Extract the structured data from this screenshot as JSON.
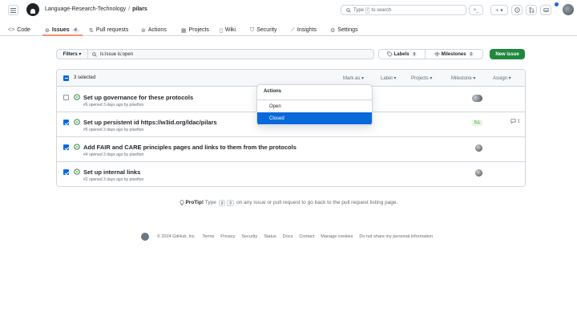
{
  "header": {
    "owner": "Language-Research-Technology",
    "separator": "/",
    "repo": "pilars",
    "search_prefix": "Type",
    "search_key": "/",
    "search_suffix": "to search",
    "terminal_label": ">_",
    "plus_label": "+ ▾"
  },
  "tabs": [
    {
      "icon": "<>",
      "label": "Code"
    },
    {
      "icon": "⊙",
      "label": "Issues",
      "count": "4"
    },
    {
      "icon": "⇅",
      "label": "Pull requests"
    },
    {
      "icon": "⊛",
      "label": "Actions"
    },
    {
      "icon": "▦",
      "label": "Projects"
    },
    {
      "icon": "▯",
      "label": "Wiki"
    },
    {
      "icon": "⛉",
      "label": "Security"
    },
    {
      "icon": "⟋",
      "label": "Insights"
    },
    {
      "icon": "⚙",
      "label": "Settings"
    }
  ],
  "filter_bar": {
    "filters_label": "Filters ▾",
    "query": "is:issue is:open",
    "labels_label": "Labels",
    "labels_count": "9",
    "milestones_label": "Milestones",
    "milestones_count": "0",
    "new_issue_label": "New issue"
  },
  "list_header": {
    "selected_text": "3 selected",
    "mark_as": "Mark as ▾",
    "label": "Label ▾",
    "projects": "Projects ▾",
    "milestone": "Milestone ▾",
    "assignee": "Assign ▾"
  },
  "issues": [
    {
      "title": "Set up governance for these protocols",
      "meta": "#6 opened 3 days ago by ptsefton",
      "checked": false
    },
    {
      "title": "Set up persistent id https://w3id.org/ldac/pilars",
      "meta": "#5 opened 3 days ago by ptsefton",
      "checked": true,
      "comments": "1",
      "assignee_label": "!LL"
    },
    {
      "title": "Add FAIR and CARE principles pages and links to them from the protocols",
      "meta": "#4 opened 3 days ago by ptsefton",
      "checked": true
    },
    {
      "title": "Set up internal links",
      "meta": "#2 opened 3 days ago by ptsefton",
      "checked": true
    }
  ],
  "menu": {
    "title": "Actions",
    "items": [
      "Open",
      "Closed"
    ],
    "highlighted": "Closed"
  },
  "protip": {
    "label": "ProTip!",
    "before": "Type",
    "key1": "g",
    "key2": "p",
    "after": "on any issue or pull request to go back to the pull request listing page."
  },
  "footer": [
    "© 2024 GitHub, Inc.",
    "Terms",
    "Privacy",
    "Security",
    "Status",
    "Docs",
    "Contact",
    "Manage cookies",
    "Do not share my personal information"
  ],
  "colors": {
    "accent": "#0969da",
    "primary_button": "#1f883d",
    "open_state": "#1a7f37",
    "tab_underline": "#fd8c73"
  }
}
